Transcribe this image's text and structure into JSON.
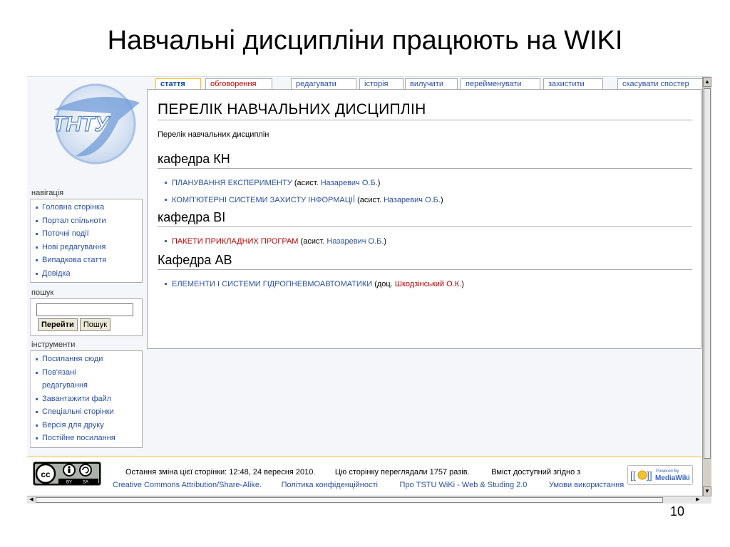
{
  "slide": {
    "title": "Навчальні дисципліни працюють на WIKI",
    "number": "10"
  },
  "logo": {
    "text": "ТНТУ"
  },
  "tabs": [
    {
      "label": "стаття",
      "selected": true
    },
    {
      "label": "обговорення",
      "red": true
    },
    {
      "label": "редагувати"
    },
    {
      "label": "історія"
    },
    {
      "label": "вилучити"
    },
    {
      "label": "перейменувати"
    },
    {
      "label": "захистити"
    },
    {
      "label": "скасувати спостер"
    }
  ],
  "sidebar": {
    "navigation": {
      "heading": "навігація",
      "items": [
        "Головна сторінка",
        "Портал спільноти",
        "Поточні події",
        "Нові редагування",
        "Випадкова стаття",
        "Довідка"
      ]
    },
    "search": {
      "heading": "пошук",
      "go_label": "Перейти",
      "search_label": "Пошук",
      "value": ""
    },
    "tools": {
      "heading": "інструменти",
      "items": [
        "Посилання сюди",
        "Пов'язані редагування",
        "Завантажити файл",
        "Спеціальні сторінки",
        "Версія для друку",
        "Постійне посилання"
      ]
    }
  },
  "page": {
    "title": "ПЕРЕЛІК НАВЧАЛЬНИХ ДИСЦИПЛІН",
    "subtitle": "Перелік навчальних дисциплін",
    "sections": [
      {
        "heading": "кафедра КН",
        "items": [
          {
            "course": "ПЛАНУВАННЯ ЕКСПЕРИМЕНТУ",
            "course_new": false,
            "role": "асист.",
            "teacher": "Назаревич О.Б.",
            "teacher_new": false
          },
          {
            "course": "КОМП'ЮТЕРНІ СИСТЕМИ ЗАХИСТУ ІНФОРМАЦІЇ",
            "course_new": false,
            "role": "асист.",
            "teacher": "Назаревич О.Б.",
            "teacher_new": false
          }
        ]
      },
      {
        "heading": "кафедра ВІ",
        "items": [
          {
            "course": "ПАКЕТИ ПРИКЛАДНИХ ПРОГРАМ",
            "course_new": true,
            "role": "асист.",
            "teacher": "Назаревич О.Б.",
            "teacher_new": false
          }
        ]
      },
      {
        "heading": "Кафедра АВ",
        "items": [
          {
            "course": "ЕЛЕМЕНТИ І СИСТЕМИ ГІДРОПНЕВМОАВТОМАТИКИ",
            "course_new": false,
            "role": "доц.",
            "teacher": "Шкодзінський О.К.",
            "teacher_new": true
          }
        ]
      }
    ]
  },
  "footer": {
    "last_modified": "Остання зміна цієї сторінки: 12:48, 24 вересня 2010.",
    "views": "Цю сторінку переглядали 1757 разів.",
    "license_prefix": "Вміст доступний згідно з",
    "license_link": "Creative Commons Attribution/Share-Alike.",
    "privacy": "Політика конфіденційності",
    "about": "Про TSTU WiKi - Web & Studing 2.0",
    "terms": "Умови використання",
    "cc_labels": [
      "BY",
      "SA"
    ],
    "mediawiki_badge": [
      "Powered By",
      "MediaWiki"
    ]
  },
  "colors": {
    "link": "#2a4fa3",
    "new_link": "#ba0000",
    "tab_selected_border": "#fabd23"
  }
}
